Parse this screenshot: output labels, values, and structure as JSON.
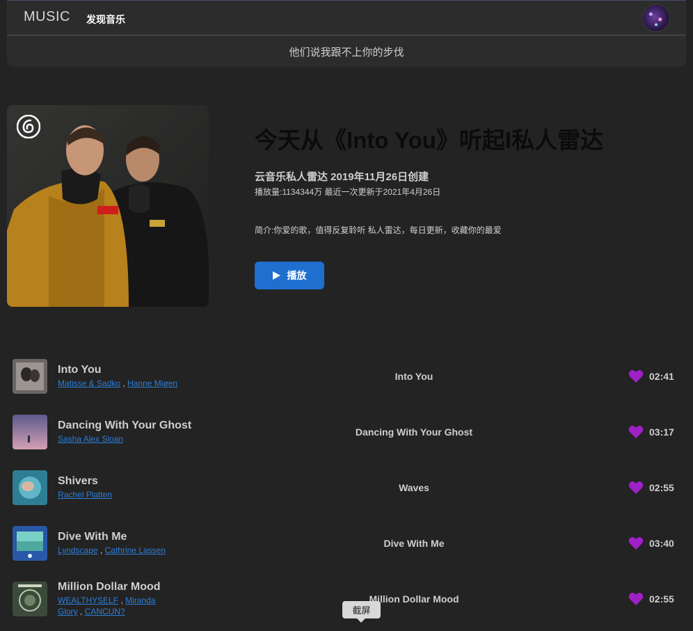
{
  "header": {
    "logo": "MUSIC",
    "nav_discover": "发现音乐",
    "lyric": "他们说我跟不上你的步伐"
  },
  "playlist": {
    "title": "今天从《Into You》听起I私人雷达",
    "creator_line": "云音乐私人雷达 2019年11月26日创建",
    "meta_line": "播放量:1134344万 最近一次更新于2021年4月26日",
    "description": "简介:你爱的歌，值得反复聆听 私人雷达，每日更新，收藏你的最爱",
    "play_label": "播放"
  },
  "songs": [
    {
      "name": "Into You",
      "artists": [
        "Matisse & Sadko",
        "Hanne Mjøen"
      ],
      "album": "Into You",
      "duration": "02:41"
    },
    {
      "name": "Dancing With Your Ghost",
      "artists": [
        "Sasha Alex Sloan"
      ],
      "album": "Dancing With Your Ghost",
      "duration": "03:17"
    },
    {
      "name": "Shivers",
      "artists": [
        "Rachel Platten"
      ],
      "album": "Waves",
      "duration": "02:55"
    },
    {
      "name": "Dive With Me",
      "artists": [
        "Lyndscape",
        "Cathrine Lassen"
      ],
      "album": "Dive With Me",
      "duration": "03:40"
    },
    {
      "name": "Million Dollar Mood",
      "artists": [
        "WEALTHYSELF",
        "Miranda Glory",
        "CANCUN?"
      ],
      "album": "Million Dollar Mood",
      "duration": "02:55"
    }
  ],
  "tooltip": "截屏",
  "colors": {
    "background": "#232323",
    "accent_blue": "#1e6fd0",
    "link_blue": "#2d7fd9",
    "heart_purple": "#a020c8"
  }
}
